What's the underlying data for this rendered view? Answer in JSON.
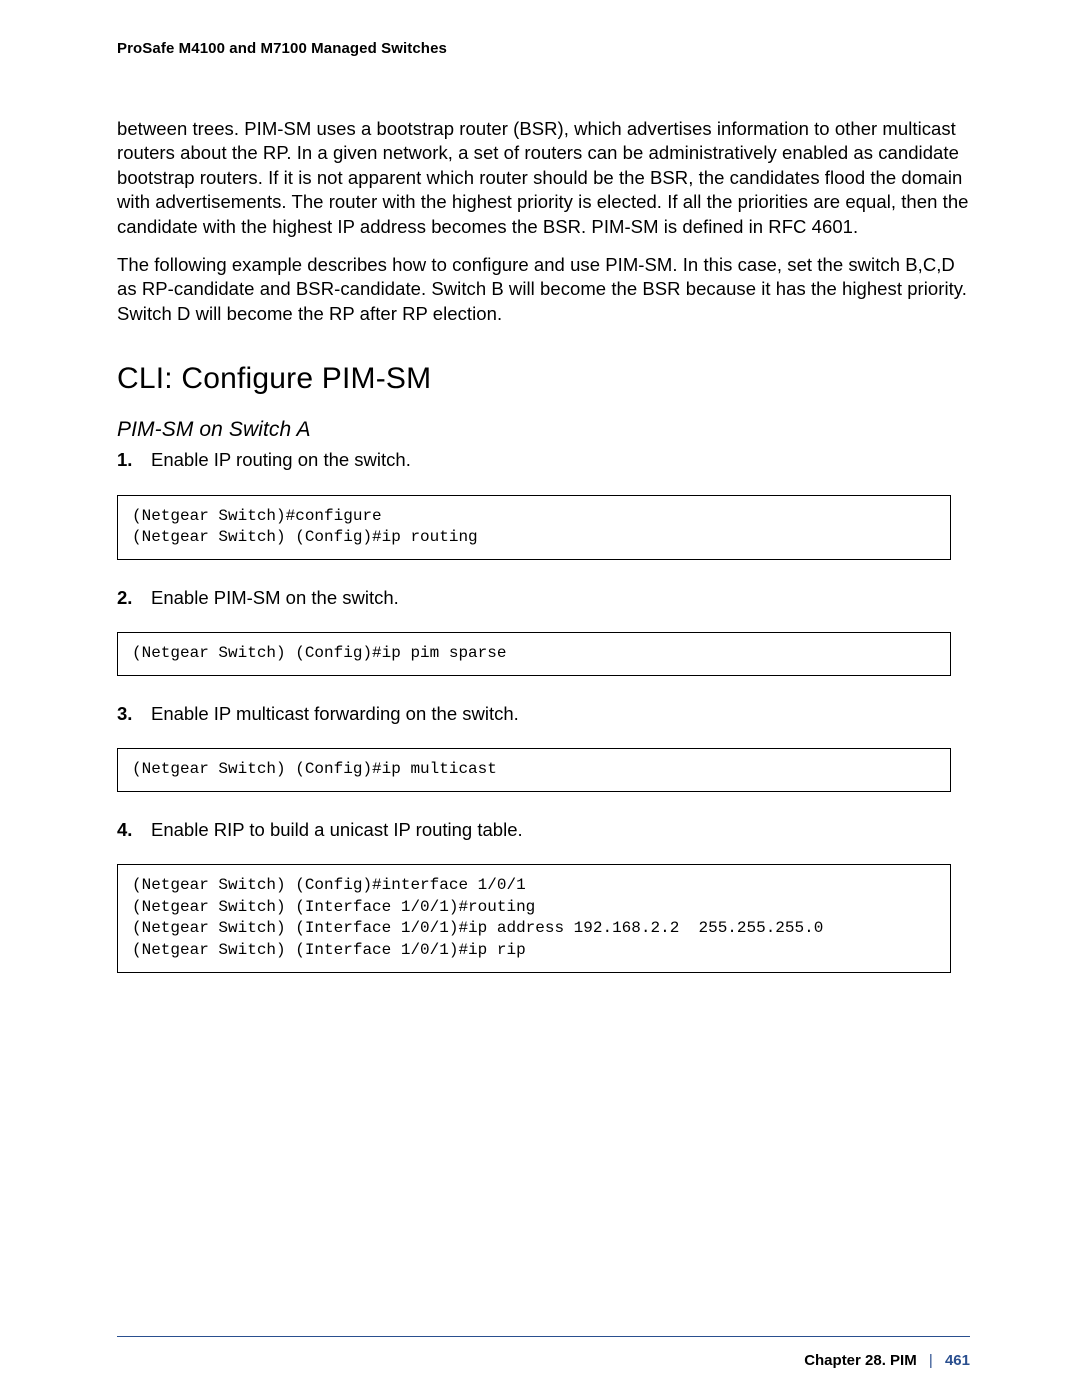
{
  "header": {
    "product_line": "ProSafe M4100 and M7100 Managed Switches"
  },
  "paragraphs": {
    "p1": "between trees. PIM-SM uses a bootstrap router (BSR), which advertises information to other multicast routers about the RP. In a given network, a set of routers can be administratively enabled as candidate bootstrap routers. If it is not apparent which router should be the BSR, the candidates flood the domain with advertisements. The router with the highest priority is elected. If all the priorities are equal, then the candidate with the highest IP address becomes the BSR. PIM-SM is defined in RFC 4601.",
    "p2": "The following example describes how to configure and use PIM-SM. In this case, set the switch B,C,D as RP-candidate and BSR-candidate. Switch B will become the BSR because it has the highest priority. Switch D will become the RP after RP election."
  },
  "headings": {
    "h1": "CLI: Configure PIM-SM",
    "h2": "PIM-SM on Switch A"
  },
  "steps": [
    "Enable IP routing on the switch.",
    "Enable PIM-SM on the switch.",
    "Enable IP multicast forwarding on the switch.",
    "Enable RIP to build a unicast IP routing table."
  ],
  "code": {
    "c1": "(Netgear Switch)#configure \n(Netgear Switch) (Config)#ip routing",
    "c2": "(Netgear Switch) (Config)#ip pim sparse",
    "c3": "(Netgear Switch) (Config)#ip multicast",
    "c4": "(Netgear Switch) (Config)#interface 1/0/1\n(Netgear Switch) (Interface 1/0/1)#routing\n(Netgear Switch) (Interface 1/0/1)#ip address 192.168.2.2  255.255.255.0\n(Netgear Switch) (Interface 1/0/1)#ip rip"
  },
  "footer": {
    "chapter": "Chapter 28.  PIM",
    "separator": "|",
    "page": "461"
  }
}
